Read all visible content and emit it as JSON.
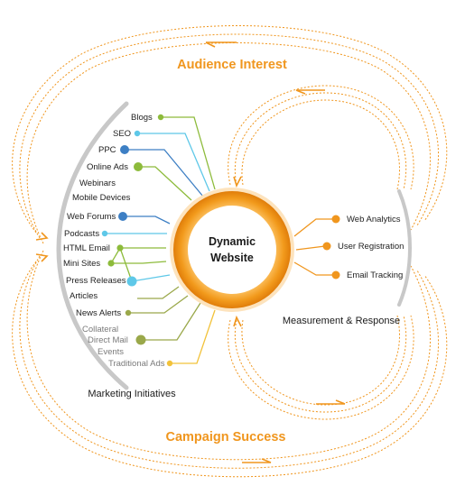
{
  "center": {
    "line1": "Dynamic",
    "line2": "Website"
  },
  "top_label": "Audience Interest",
  "bottom_label": "Campaign Success",
  "left_caption": "Marketing Initiatives",
  "right_caption": "Measurement & Response",
  "initiatives": [
    "Blogs",
    "SEO",
    "PPC",
    "Online Ads",
    "Webinars",
    "Mobile Devices",
    "Web Forums",
    "Podcasts",
    "HTML Email",
    "Mini Sites",
    "Press Releases",
    "Articles",
    "News Alerts",
    "Collateral",
    "Direct Mail",
    "Events",
    "Traditional Ads"
  ],
  "measurements": [
    "Web Analytics",
    "User Registration",
    "Email Tracking"
  ],
  "colors": {
    "orange": "#f0961e",
    "green": "#8dbb3b",
    "blue": "#3d7fc4",
    "cyan": "#5ec8e8",
    "olive": "#9aa84a",
    "yellow": "#f2c23a",
    "gray_arc": "#c8c8c8"
  }
}
